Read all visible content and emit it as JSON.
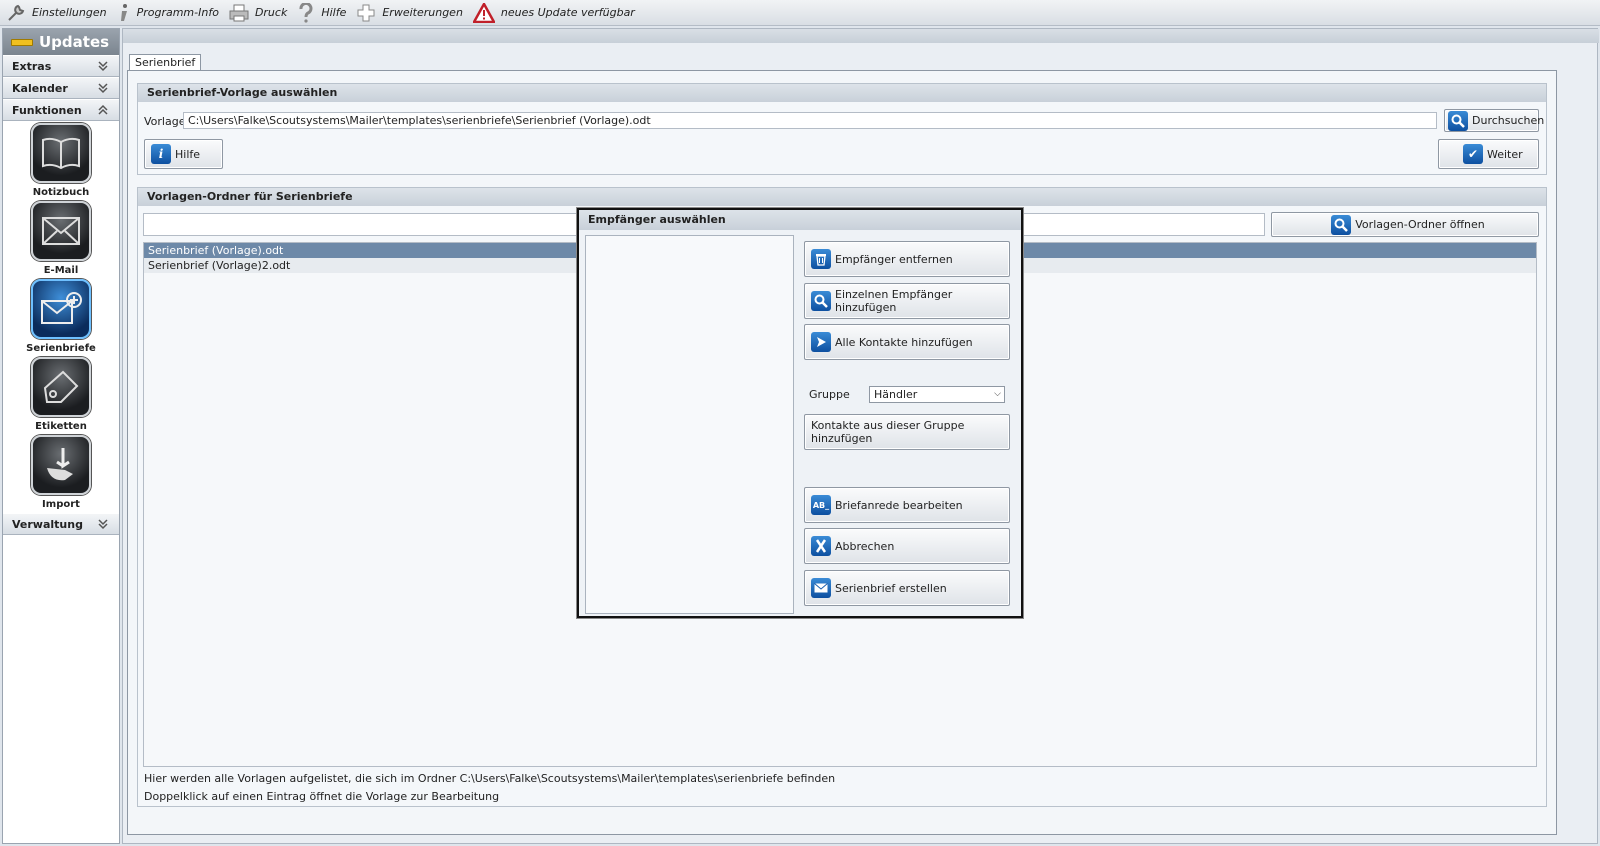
{
  "toolbar": {
    "items": [
      {
        "label": "Einstellungen",
        "icon": "wrench-icon"
      },
      {
        "label": "Programm-Info",
        "icon": "info-icon"
      },
      {
        "label": "Druck",
        "icon": "printer-icon"
      },
      {
        "label": "Hilfe",
        "icon": "question-icon"
      },
      {
        "label": "Erweiterungen",
        "icon": "plus-icon"
      },
      {
        "label": "neues Update verfügbar",
        "icon": "warning-icon"
      }
    ]
  },
  "sidebar": {
    "header": "Updates",
    "sections": {
      "extras": "Extras",
      "kalender": "Kalender",
      "funktionen": "Funktionen",
      "verwaltung": "Verwaltung"
    },
    "tiles": [
      {
        "label": "Notizbuch",
        "icon": "notebook-icon"
      },
      {
        "label": "E-Mail",
        "icon": "envelope-icon"
      },
      {
        "label": "Serienbriefe",
        "icon": "envelope-plus-icon"
      },
      {
        "label": "Etiketten",
        "icon": "tag-icon"
      },
      {
        "label": "Import",
        "icon": "import-icon"
      }
    ]
  },
  "main": {
    "tab": "Serienbrief",
    "template_group": {
      "title": "Serienbrief-Vorlage auswählen",
      "label": "Vorlage",
      "path": "C:\\Users\\Falke\\Scoutsystems\\Mailer\\templates\\serienbriefe\\Serienbrief (Vorlage).odt",
      "browse_button": "Durchsuchen",
      "help_button": "Hilfe",
      "next_button": "Weiter"
    },
    "folder_group": {
      "title": "Vorlagen-Ordner für Serienbriefe",
      "open_folder_button": "Vorlagen-Ordner öffnen",
      "files": [
        "Serienbrief (Vorlage).odt",
        "Serienbrief (Vorlage)2.odt"
      ],
      "note1": "Hier werden alle Vorlagen aufgelistet, die sich im Ordner C:\\Users\\Falke\\Scoutsystems\\Mailer\\templates\\serienbriefe befinden",
      "note2": "Doppelklick auf einen Eintrag öffnet die Vorlage zur Bearbeitung"
    }
  },
  "dialog": {
    "title": "Empfänger auswählen",
    "remove_button": "Empfänger entfernen",
    "add_single_button": "Einzelnen Empfänger hinzufügen",
    "add_all_button": "Alle Kontakte hinzufügen",
    "group_label": "Gruppe",
    "group_value": "Händler",
    "add_group_button": "Kontakte aus dieser Gruppe hinzufügen",
    "salutation_button": "Briefanrede bearbeiten",
    "salutation_icon_text": "AB_",
    "cancel_button": "Abbrechen",
    "create_button": "Serienbrief erstellen"
  }
}
